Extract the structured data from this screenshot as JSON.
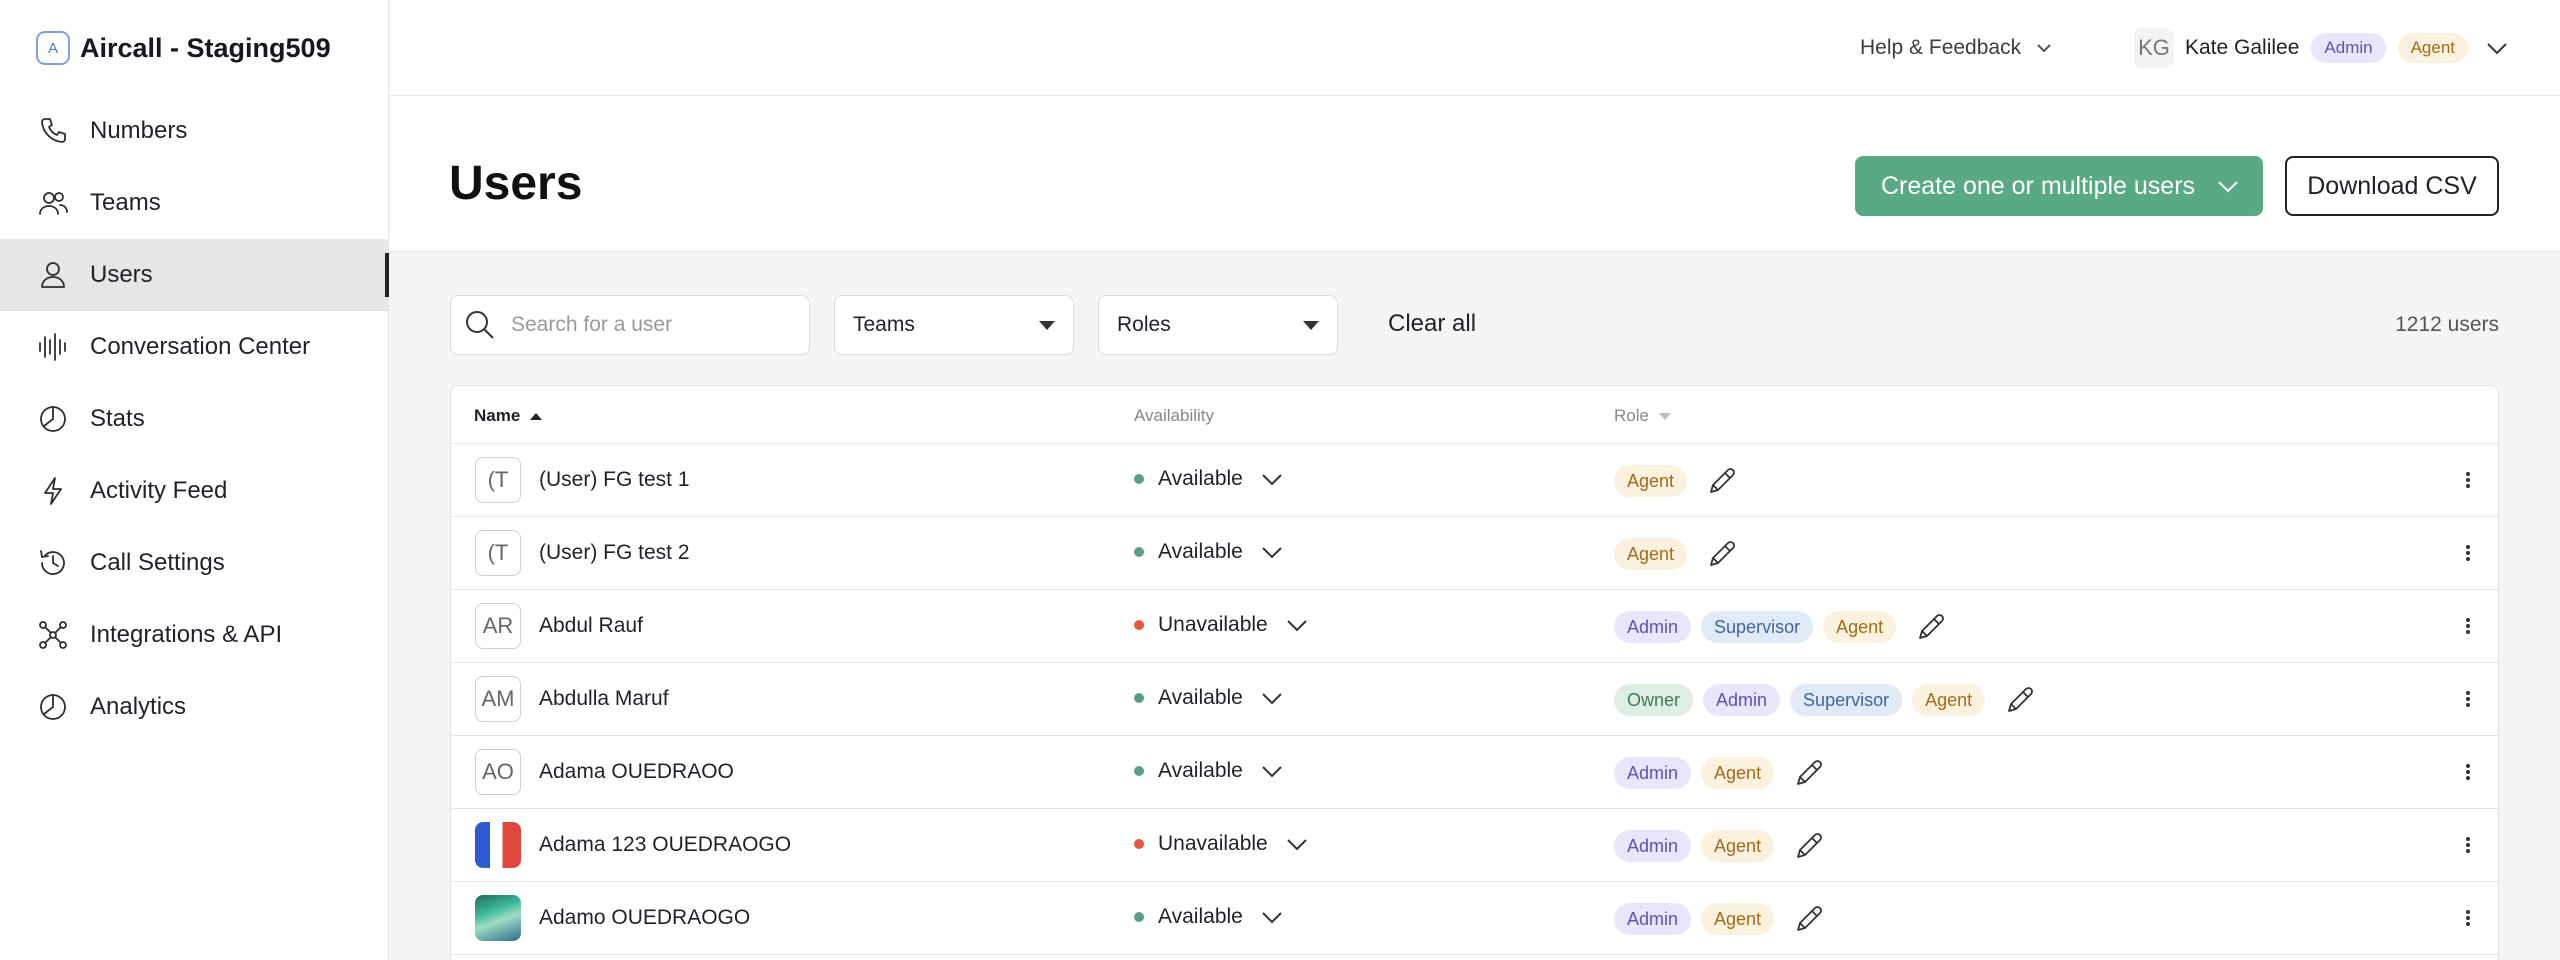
{
  "app": {
    "title": "Aircall - Staging509",
    "logo_letter": "A"
  },
  "sidebar": {
    "items": [
      {
        "label": "Numbers",
        "icon": "phone-icon",
        "active": false
      },
      {
        "label": "Teams",
        "icon": "team-icon",
        "active": false
      },
      {
        "label": "Users",
        "icon": "user-icon",
        "active": true
      },
      {
        "label": "Conversation Center",
        "icon": "waveform-icon",
        "active": false
      },
      {
        "label": "Stats",
        "icon": "pie-chart-icon",
        "active": false
      },
      {
        "label": "Activity Feed",
        "icon": "lightning-icon",
        "active": false
      },
      {
        "label": "Call Settings",
        "icon": "history-icon",
        "active": false
      },
      {
        "label": "Integrations & API",
        "icon": "network-icon",
        "active": false
      },
      {
        "label": "Analytics",
        "icon": "pie-chart-icon",
        "active": false
      }
    ]
  },
  "topbar": {
    "help_label": "Help & Feedback",
    "user": {
      "initials": "KG",
      "name": "Kate Galilee",
      "roles": [
        "Admin",
        "Agent"
      ]
    }
  },
  "page": {
    "title": "Users",
    "create_button": "Create one or multiple users",
    "csv_button": "Download CSV"
  },
  "filters": {
    "search_placeholder": "Search for a user",
    "teams_label": "Teams",
    "roles_label": "Roles",
    "clear_all": "Clear all",
    "user_count": "1212 users"
  },
  "table": {
    "columns": {
      "name": "Name",
      "availability": "Availability",
      "role": "Role"
    },
    "rows": [
      {
        "avatar": "(T",
        "avatar_type": "initials",
        "name": "(User) FG test 1",
        "availability": "Available",
        "status": "available",
        "roles": [
          "Agent"
        ]
      },
      {
        "avatar": "(T",
        "avatar_type": "initials",
        "name": "(User) FG test 2",
        "availability": "Available",
        "status": "available",
        "roles": [
          "Agent"
        ]
      },
      {
        "avatar": "AR",
        "avatar_type": "initials",
        "name": "Abdul Rauf",
        "availability": "Unavailable",
        "status": "unavailable",
        "roles": [
          "Admin",
          "Supervisor",
          "Agent"
        ]
      },
      {
        "avatar": "AM",
        "avatar_type": "initials",
        "name": "Abdulla Maruf",
        "availability": "Available",
        "status": "available",
        "roles": [
          "Owner",
          "Admin",
          "Supervisor",
          "Agent"
        ]
      },
      {
        "avatar": "AO",
        "avatar_type": "initials",
        "name": "Adama OUEDRAOO",
        "availability": "Available",
        "status": "available",
        "roles": [
          "Admin",
          "Agent"
        ]
      },
      {
        "avatar": "",
        "avatar_type": "flag",
        "name": "Adama 123 OUEDRAOGO",
        "availability": "Unavailable",
        "status": "unavailable",
        "roles": [
          "Admin",
          "Agent"
        ]
      },
      {
        "avatar": "",
        "avatar_type": "aurora",
        "name": "Adamo OUEDRAOGO",
        "availability": "Available",
        "status": "available",
        "roles": [
          "Admin",
          "Agent"
        ]
      }
    ]
  },
  "colors": {
    "accent": "#5aa985",
    "available": "#5a9f83",
    "unavailable": "#e8573f",
    "admin_badge": "#e9e6fb",
    "agent_badge": "#fbf1df",
    "supervisor_badge": "#e1ebf8",
    "owner_badge": "#ddeee3"
  }
}
